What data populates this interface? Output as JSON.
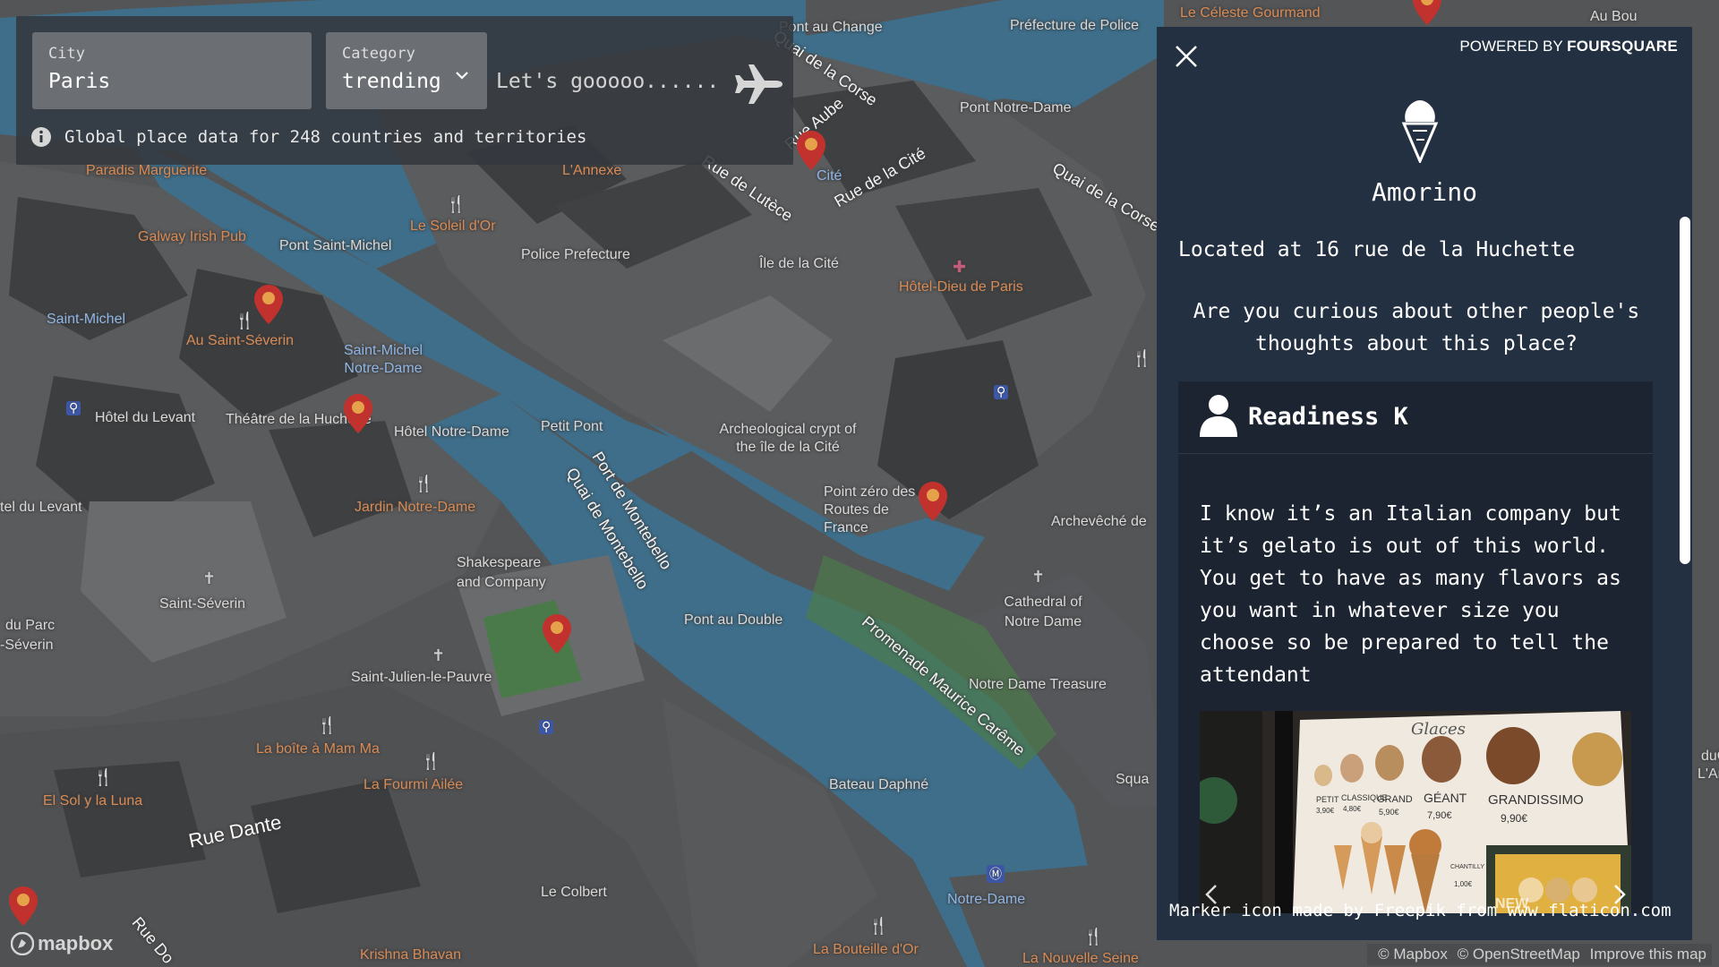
{
  "search": {
    "city_label": "City",
    "city_value": "Paris",
    "category_label": "Category",
    "category_value": "trending",
    "go_placeholder": "Let's gooooo......",
    "info_text": "Global place data for 248 countries and territories"
  },
  "detail": {
    "powered_prefix": "POWERED BY",
    "powered_brand": "FOURSQUARE",
    "place_name": "Amorino",
    "address": "Located at 16 rue de la Huchette",
    "curious": "Are you curious about other people's thoughts about this place?",
    "review": {
      "user": "Readiness K",
      "text": "I know it’s an Italian company but it’s gelato is out of this world. You get to have as many flavors as you want in whatever size you choose so be prepared to tell the attendant"
    },
    "photo": {
      "title": "Glaces",
      "items": [
        {
          "name": "PETIT",
          "price": "3,90€"
        },
        {
          "name": "CLASSIQUE",
          "price": "4,80€"
        },
        {
          "name": "GRAND",
          "price": "5,90€"
        },
        {
          "name": "GÉANT",
          "price": "7,90€"
        },
        {
          "name": "GRANDISSIMO",
          "price": "9,90€"
        }
      ],
      "extra_label": "CHANTILLY MAISON",
      "extra_price": "1,00€",
      "new_label": "NEW"
    },
    "attribution": "Marker icon made by Freepik from www.flaticon.com"
  },
  "map": {
    "streets": [
      "Rue de la Cité",
      "Rue de Lutèce",
      "Quai de la Corse",
      "Quai de Montebello",
      "Port de Montebello",
      "Promenade Maurice Carême",
      "Rue Dante",
      "Rue Do",
      "Rue Aube",
      "Quai de la Corse"
    ],
    "labels": [
      "Le Céleste Gourmand",
      "Préfecture de Police",
      "Pont au Change",
      "Pont Notre-Dame",
      "Paradis Marguerite",
      "L'Annexe",
      "Cité",
      "Le Soleil d'Or",
      "Galway Irish Pub",
      "Pont Saint-Michel",
      "Police Prefecture",
      "Île de la Cité",
      "Hôtel-Dieu de Paris",
      "Saint-Michel",
      "Au Saint-Séverin",
      "Saint-Michel Notre-Dame",
      "Hôtel du Levant",
      "Théâtre de la Huchette",
      "Hôtel Notre-Dame",
      "Petit Pont",
      "Archeological crypt of the île de la Cité",
      "Point zéro des Routes de France",
      "Archevêché de",
      "Jardin Notre-Dame",
      "Shakespeare and Company",
      "Saint-Séverin",
      "Cathedral of Notre Dame",
      "Pont au Double",
      "Saint-Julien-le-Pauvre",
      "Notre Dame Treasure",
      "La boîte à Mam Ma",
      "La Fourmi Ailée",
      "El Sol y la Luna",
      "Bateau Daphné",
      "Le Colbert",
      "Notre-Dame",
      "Krishna Bhavan",
      "La Bouteille d'Or",
      "La Nouvelle Seine",
      "du Parc",
      "-Séverin",
      "tel du Levant",
      "Squa",
      "Au Bou",
      "L'Arc",
      "duO",
      "Ile",
      "La"
    ],
    "logo": "mapbox",
    "credits": [
      "© Mapbox",
      "© OpenStreetMap",
      "Improve this map"
    ]
  },
  "colors": {
    "panel_bg": "#233041",
    "review_bg": "#1b2430",
    "search_bg": "#34383e",
    "field_bg": "#6b6e73",
    "water": "#3c6e8a",
    "pin": "#c1322e",
    "pin_dot": "#e6a24a",
    "poi": "#d88a55"
  },
  "icons": [
    "airplane-icon",
    "info-icon",
    "chevron-down-icon",
    "close-icon",
    "ice-cream-icon",
    "user-icon",
    "chevron-left-icon",
    "chevron-right-icon",
    "map-pin-icon"
  ]
}
